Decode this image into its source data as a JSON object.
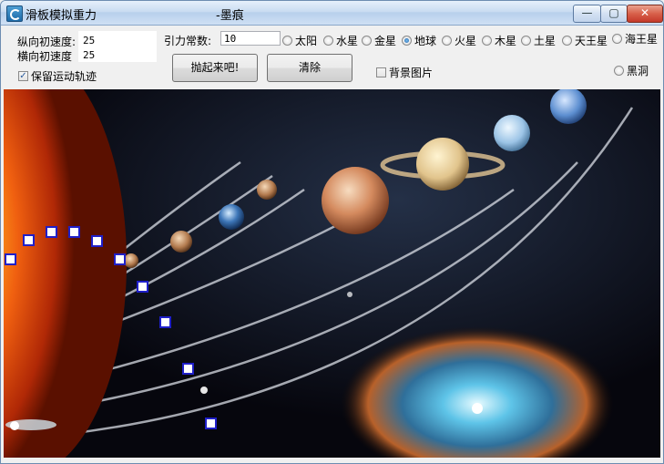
{
  "window": {
    "title": "滑板模拟重力",
    "author": "-墨痕",
    "buttons": {
      "minimize": "—",
      "maximize": "▢",
      "close": "✕"
    }
  },
  "controls": {
    "vertical_velocity_label": "纵向初速度:",
    "vertical_velocity_value": "25",
    "horizontal_velocity_label": "横向初速度",
    "horizontal_velocity_value": "25",
    "keep_trail_label": "保留运动轨迹",
    "keep_trail_checked": true,
    "gravity_label": "引力常数:",
    "gravity_value": "10",
    "throw_button": "抛起来吧!",
    "clear_button": "清除",
    "background_label": "背景图片",
    "background_checked": false
  },
  "planets": {
    "selected": "地球",
    "options": [
      "太阳",
      "水星",
      "金星",
      "地球",
      "火星",
      "木星",
      "土星",
      "天王星",
      "海王星",
      "黑洞"
    ]
  },
  "trail_points": 10,
  "colors": {
    "marker_border": "#1f1fc8",
    "accent": "#1a5ea9",
    "title_gradient": "#c9dcf1"
  }
}
